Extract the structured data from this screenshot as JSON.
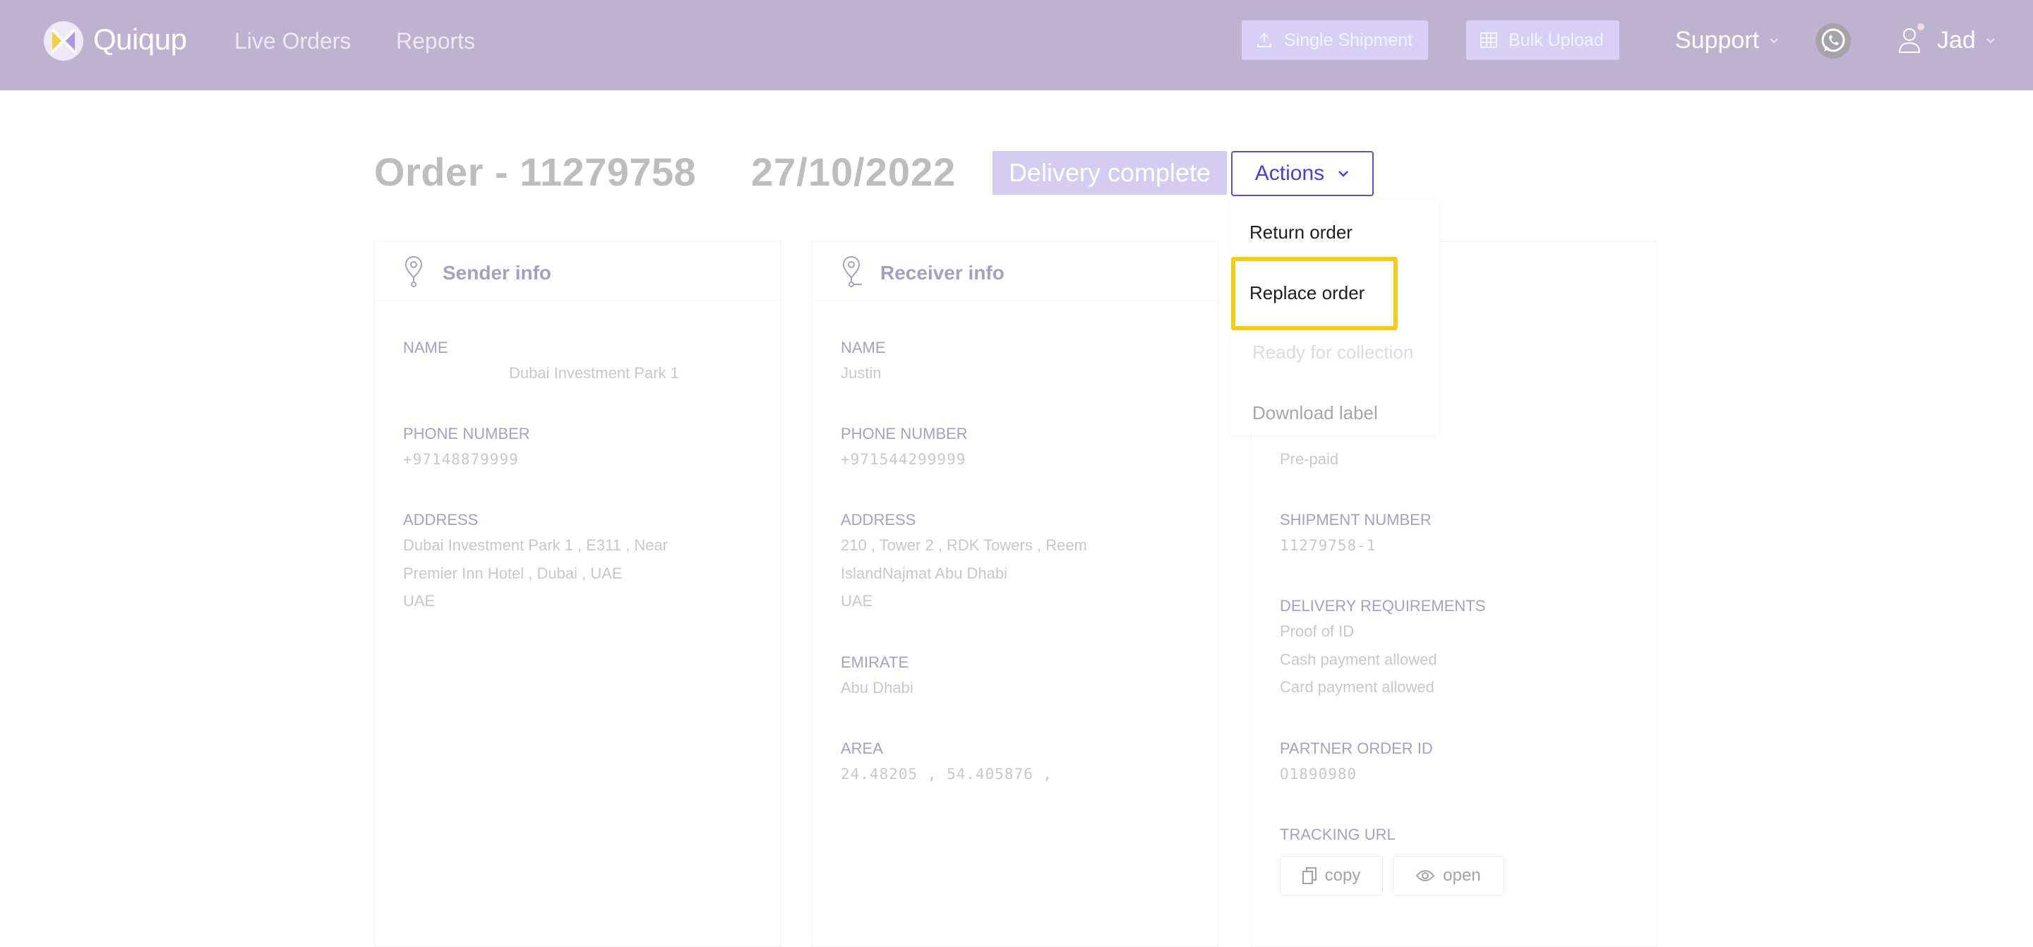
{
  "header": {
    "brand": "Quiqup",
    "nav": [
      "Live Orders",
      "Reports"
    ],
    "single_shipment": "Single Shipment",
    "bulk_upload": "Bulk Upload",
    "support": "Support",
    "user_name": "Jad"
  },
  "order": {
    "title": "Order - 11279758",
    "date": "27/10/2022",
    "status": "Delivery complete",
    "actions_label": "Actions"
  },
  "actions_menu": {
    "items": [
      "Return order",
      "Replace order",
      "Ready for collection",
      "Download label"
    ]
  },
  "sender": {
    "title": "Sender info",
    "name_label": "NAME",
    "name_value": "Dubai Investment Park 1",
    "phone_label": "PHONE NUMBER",
    "phone_value": "+97148879999",
    "address_label": "ADDRESS",
    "address_lines": [
      "Dubai Investment Park 1 , E311 , Near",
      "Premier Inn Hotel , Dubai , UAE",
      "UAE"
    ]
  },
  "receiver": {
    "title": "Receiver info",
    "name_label": "NAME",
    "name_value": "Justin",
    "phone_label": "PHONE NUMBER",
    "phone_value": "+971544299999",
    "address_label": "ADDRESS",
    "address_lines": [
      "210 , Tower 2 , RDK Towers , Reem",
      "IslandNajmat Abu Dhabi",
      "UAE"
    ],
    "emirate_label": "EMIRATE",
    "emirate_value": "Abu Dhabi",
    "area_label": "AREA",
    "area_value": "24.48205 , 54.405876 ,"
  },
  "shipment": {
    "payment_value": "Pre-paid",
    "shipment_number_label": "SHIPMENT NUMBER",
    "shipment_number_value": "11279758-1",
    "delivery_req_label": "DELIVERY REQUIREMENTS",
    "delivery_req_values": [
      "Proof of ID",
      "Cash payment allowed",
      "Card payment allowed"
    ],
    "partner_order_label": "PARTNER ORDER ID",
    "partner_order_value": "O1890980",
    "tracking_label": "TRACKING URL",
    "copy_label": "copy",
    "open_label": "open"
  },
  "colors": {
    "header_bg": "#bdb3d1",
    "accent": "#4a3fd0",
    "status_badge": "#d4cdf1",
    "highlight": "#f5cc15"
  },
  "icons": [
    "quiqup-logo",
    "upload-icon",
    "grid-icon",
    "chevron-down-icon",
    "whatsapp-icon",
    "user-icon",
    "location-pin-icon",
    "copy-icon",
    "eye-icon"
  ]
}
